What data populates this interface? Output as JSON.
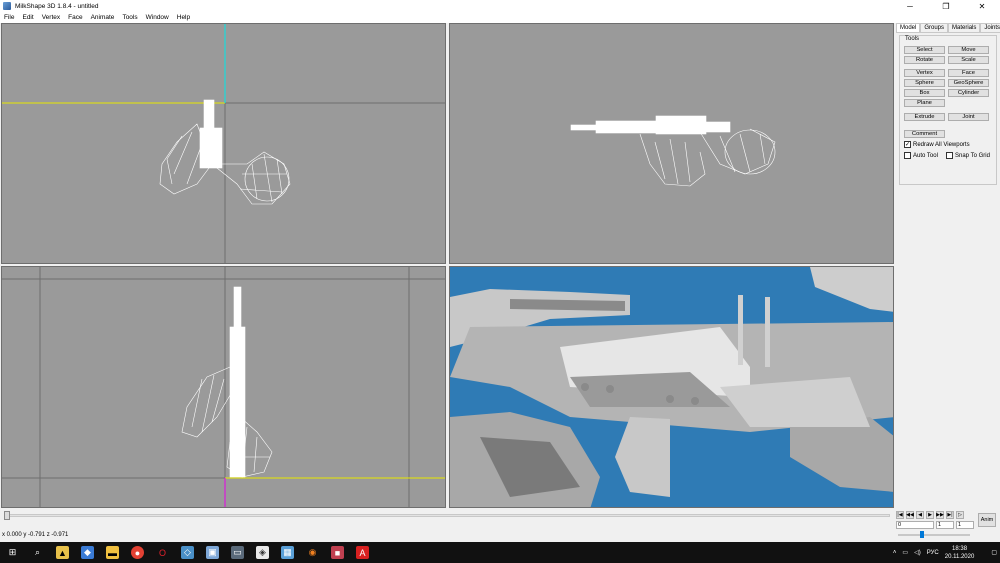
{
  "window": {
    "title": "MilkShape 3D 1.8.4 - untitled",
    "controls": [
      "─",
      "❐",
      "✕"
    ]
  },
  "menu": [
    "File",
    "Edit",
    "Vertex",
    "Face",
    "Animate",
    "Tools",
    "Window",
    "Help"
  ],
  "panel": {
    "tabs": [
      "Model",
      "Groups",
      "Materials",
      "Joints"
    ],
    "active_tab": "Model",
    "tools_label": "Tools",
    "buttons": {
      "select": "Select",
      "move": "Move",
      "rotate": "Rotate",
      "scale": "Scale",
      "vertex": "Vertex",
      "face": "Face",
      "sphere": "Sphere",
      "geosphere": "GeoSphere",
      "box": "Box",
      "cylinder": "Cylinder",
      "plane": "Plane",
      "extrude": "Extrude",
      "joint": "Joint",
      "comment": "Comment"
    },
    "checkboxes": {
      "redraw": {
        "label": "Redraw All Viewports",
        "checked": true
      },
      "auto_tool": {
        "label": "Auto Tool",
        "checked": false
      },
      "snap_grid": {
        "label": "Snap To Grid",
        "checked": false
      }
    }
  },
  "anim": {
    "button": "Anim",
    "frame_start": "0",
    "frame_current": "1",
    "frame_end": "1",
    "play_controls": [
      "|◀",
      "◀◀",
      "◀",
      "▶",
      "▶▶",
      "▶|",
      "▷"
    ]
  },
  "status": {
    "coords": "x 0.000 y -0.791 z -0.971"
  },
  "tray": {
    "lang": "РУС",
    "time": "18:38",
    "date": "20.11.2020"
  },
  "taskbar_icons": [
    "windows-start-icon",
    "search-icon",
    "task-app-icon",
    "app-icon",
    "file-explorer-icon",
    "chrome-icon",
    "opera-icon",
    "app-icon",
    "app-icon",
    "app-icon",
    "milkshape-icon",
    "calculator-icon",
    "blender-icon",
    "app-icon",
    "acrobat-icon"
  ],
  "colors": {
    "viewport_bg": "#9a9a9a",
    "viewport_3d_bg": "#2f7bb5",
    "wire": "#ffffff",
    "axis_yellow": "#e8e800",
    "axis_cyan": "#00e8e8",
    "axis_magenta": "#e800e8"
  }
}
